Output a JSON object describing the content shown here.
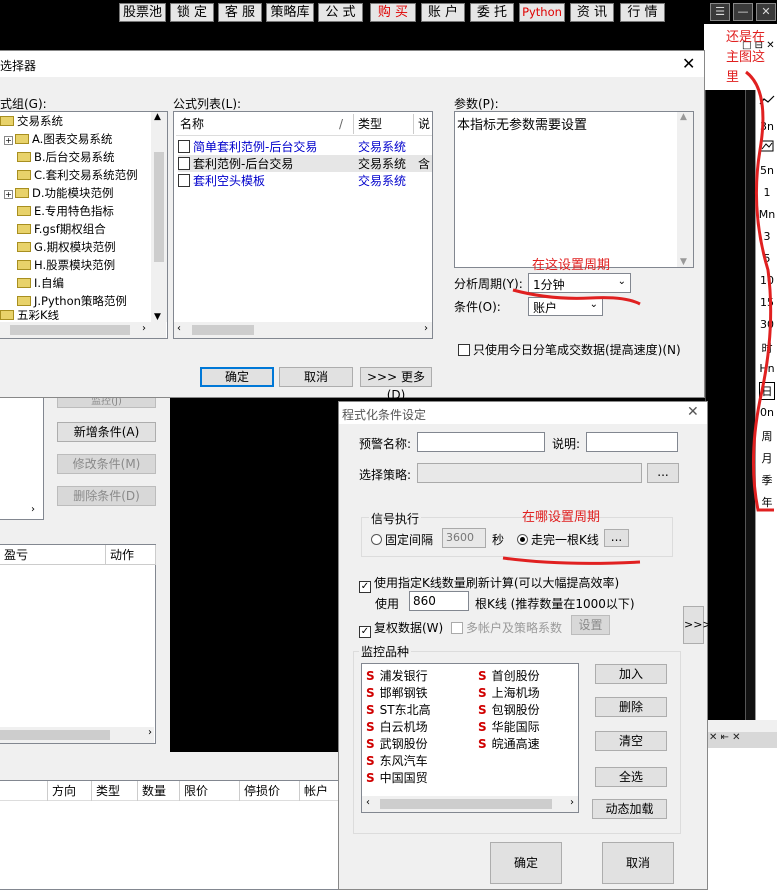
{
  "topbar": {
    "buttons": [
      "股票池",
      "锁 定",
      "客 服",
      "策略库",
      "公 式",
      "购 买",
      "账 户",
      "委 托",
      "Python",
      "资 讯",
      "行 情"
    ],
    "window_controls": [
      "☰",
      "—",
      "□",
      "✕"
    ]
  },
  "right_strip": {
    "items": [
      "3n",
      "5n",
      "1",
      "Mn",
      "3",
      "5",
      "10",
      "15",
      "30",
      "时",
      "Hn",
      "日",
      "0n",
      "周",
      "月",
      "季",
      "年"
    ],
    "mini_controls": [
      "□",
      "⊟",
      "✕"
    ]
  },
  "selector": {
    "title": "选择器",
    "group_label": "式组(G):",
    "tree": [
      "交易系统",
      "A.图表交易系统",
      "B.后台交易系统",
      "C.套利交易系统范例",
      "D.功能模块范例",
      "E.专用特色指标",
      "F.gsf期权组合",
      "G.期权模块范例",
      "H.股票模块范例",
      "I.自编",
      "J.Python策略范例",
      "五彩K线"
    ],
    "list_label": "公式列表(L):",
    "columns": [
      "名称",
      "类型",
      "说"
    ],
    "rows": [
      {
        "name": "简单套利范例-后台交易",
        "type": "交易系统",
        "extra": ""
      },
      {
        "name": "套利范例-后台交易",
        "type": "交易系统",
        "extra": "含"
      },
      {
        "name": "套利空头模板",
        "type": "交易系统",
        "extra": ""
      }
    ],
    "param_label": "参数(P):",
    "param_text": "本指标无参数需要设置",
    "period_label": "分析周期(Y):",
    "period_value": "1分钟",
    "cond_label": "条件(O):",
    "cond_value": "账户",
    "today_only": "只使用今日分笔成交数据(提高速度)(N)",
    "ok": "确定",
    "cancel": "取消",
    "more": ">>> 更多(D)"
  },
  "back_panel": {
    "monitor_btn": "监控(J)",
    "add_btn": "新增条件(A)",
    "edit_btn": "修改条件(M)",
    "del_btn": "删除条件(D)",
    "col_pnl": "盈亏",
    "col_action": "动作"
  },
  "bottom_table": {
    "columns": [
      "方向",
      "类型",
      "数量",
      "限价",
      "停损价",
      "帐户"
    ]
  },
  "cond_dialog": {
    "title": "程式化条件设定",
    "warn_name_label": "预警名称:",
    "desc_label": "说明:",
    "strategy_label": "选择策略:",
    "browse": "...",
    "signal_group": "信号执行",
    "fixed_label": "固定间隔",
    "fixed_value": "3600",
    "sec_label": "秒",
    "bar_label": "走完一根K线",
    "bar_btn": "...",
    "use_k_label": "使用指定K线数量刷新计算(可以大幅提高效率)",
    "use_label": "使用",
    "use_value": "860",
    "k_hint": "根K线 (推荐数量在1000以下)",
    "restore_label": "复权数据(W)",
    "multi_label": "多帐户及策略系数",
    "set_btn": "设置",
    "expand_btn": ">>>",
    "monitor_group": "监控品种",
    "stocks_col1": [
      "浦发银行",
      "邯郸钢铁",
      "ST东北高",
      "白云机场",
      "武钢股份",
      "东风汽车",
      "中国国贸"
    ],
    "stocks_col2": [
      "首创股份",
      "上海机场",
      "包钢股份",
      "华能国际",
      "皖通高速"
    ],
    "stock_marker": "S",
    "add": "加入",
    "remove": "删除",
    "clear": "清空",
    "select_all": "全选",
    "dynamic": "动态加载",
    "ok": "确定",
    "cancel": "取消"
  },
  "annotations": {
    "note_period": "在这设置周期",
    "note_where": "在哪设置周期",
    "note_main_l1": "还是在",
    "note_main_l2": "主图这",
    "note_main_l3": "里"
  },
  "colors": {
    "accent_red": "#e02020",
    "link_blue": "#0000cc",
    "marker_red": "#d00000"
  }
}
